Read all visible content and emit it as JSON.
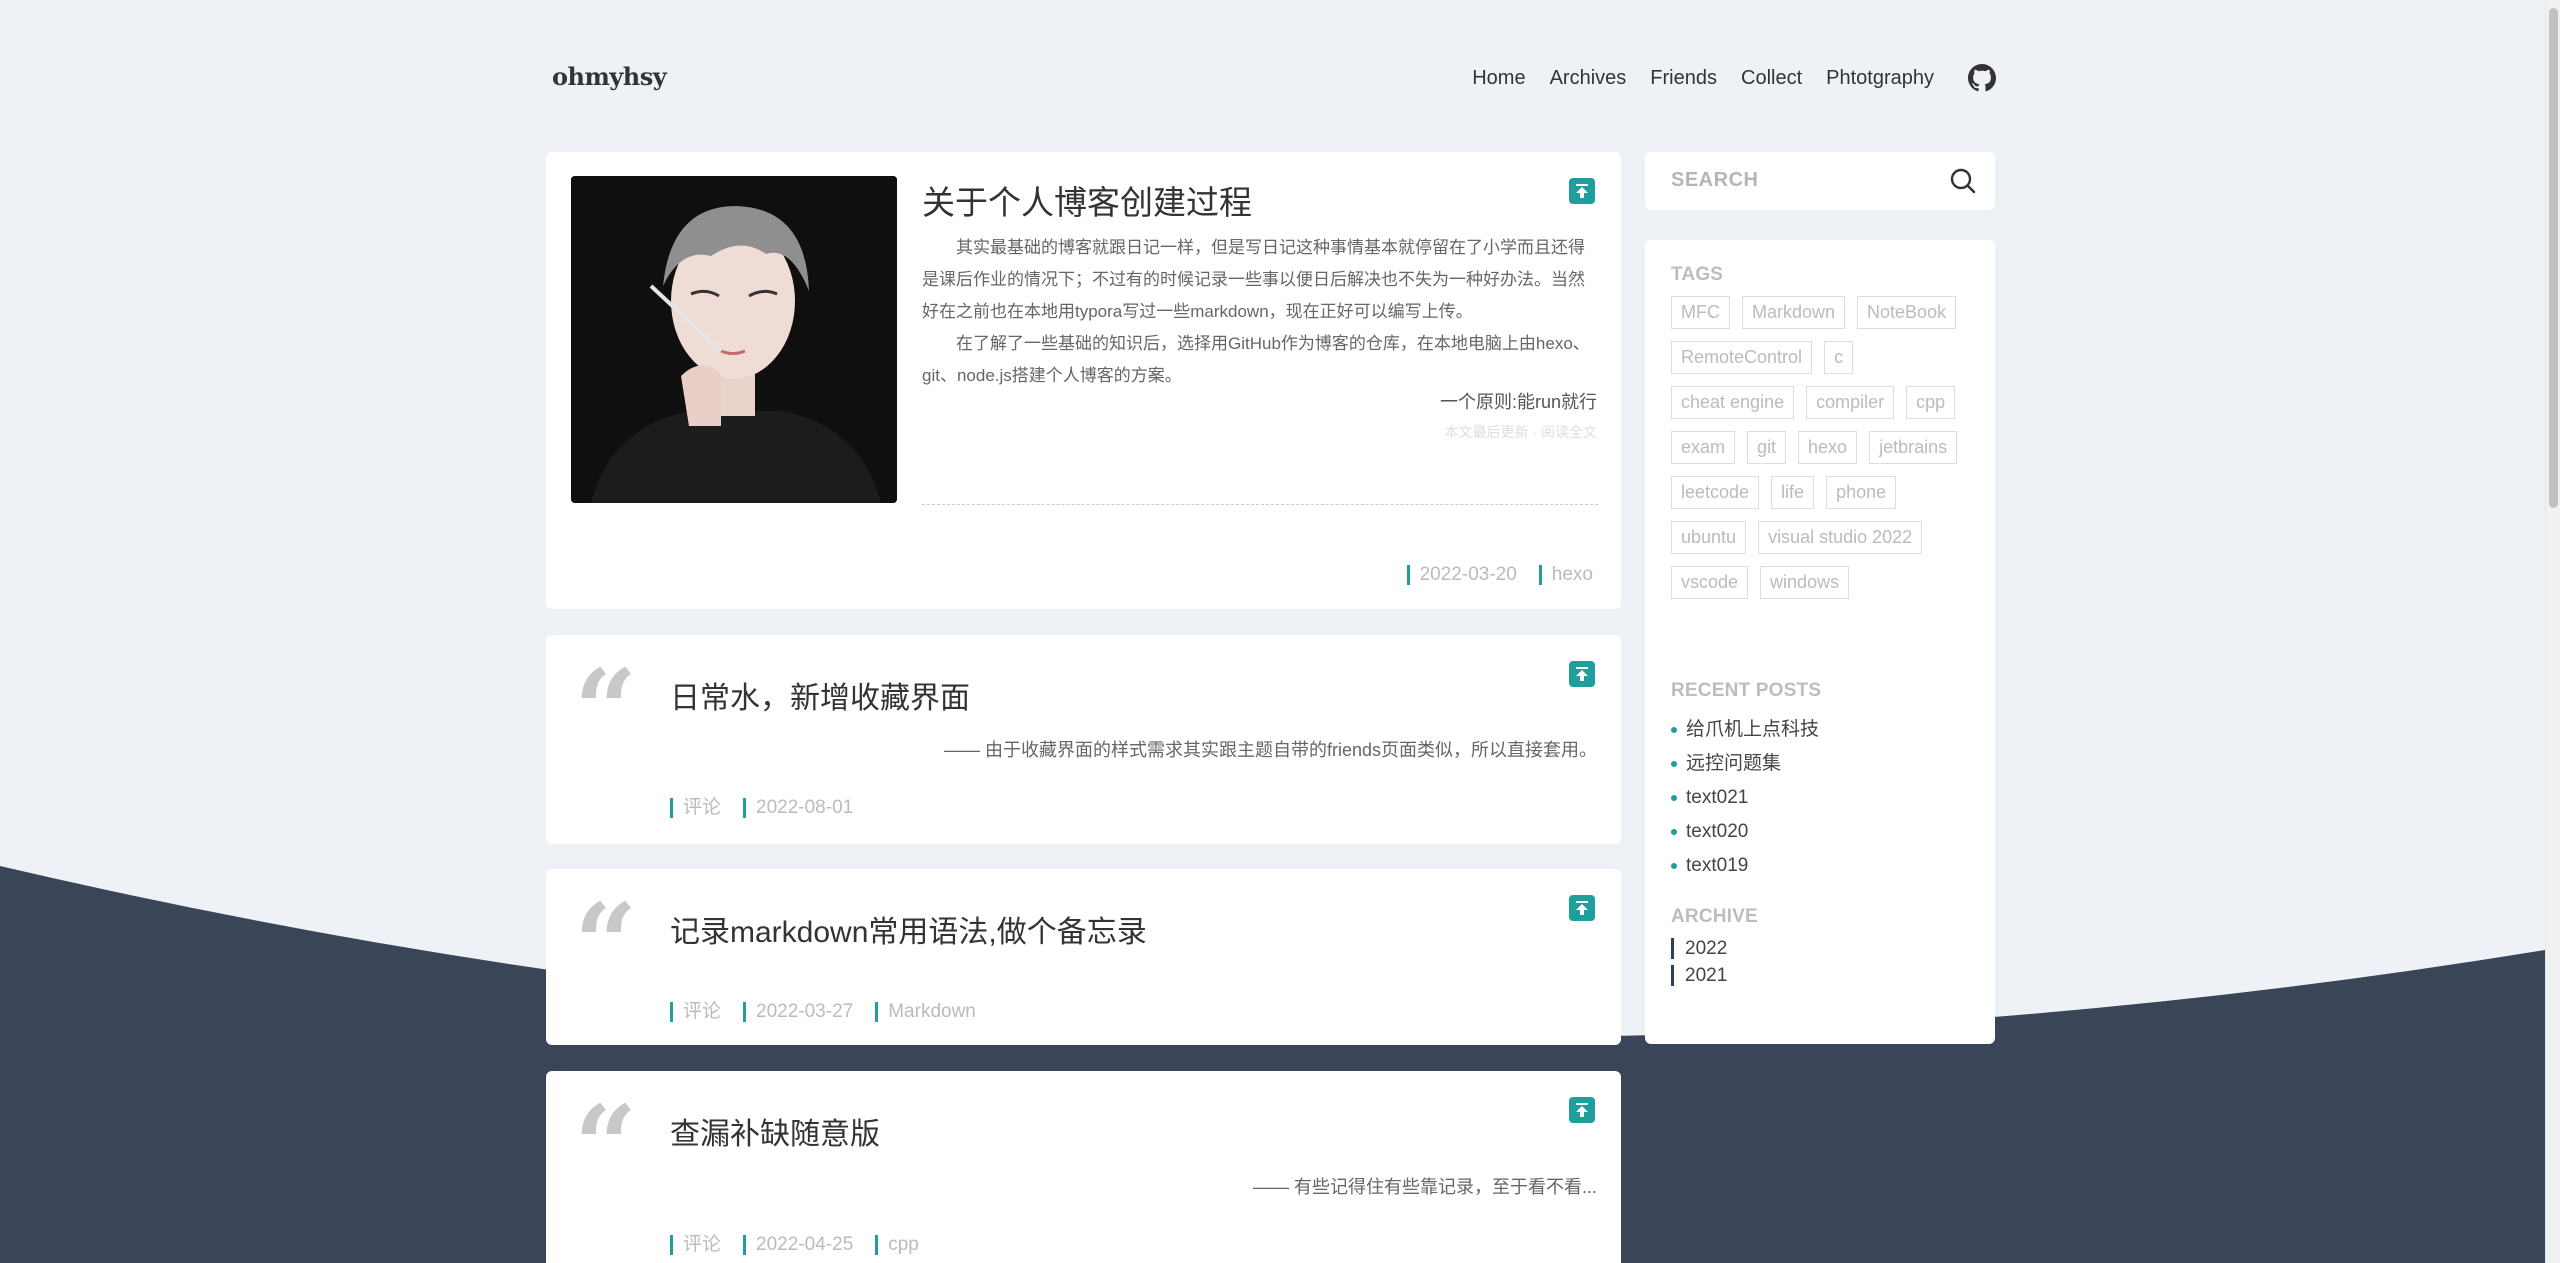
{
  "header": {
    "brand": "ohmyhsy",
    "nav": [
      "Home",
      "Archives",
      "Friends",
      "Collect",
      "Phtotgraphy"
    ]
  },
  "colors": {
    "accent": "#1f9e9e",
    "wave": "#3a4658",
    "background": "#eef2f6"
  },
  "icons": {
    "github": "github-icon",
    "search": "search-icon",
    "pin": "pin-top-icon",
    "quote": "quote-icon"
  },
  "posts": [
    {
      "title": "关于个人博客创建过程",
      "excerpt": [
        "其实最基础的博客就跟日记一样，但是写日记这种事情基本就停留在了小学而且还得是课后作业的情况下；不过有的时候记录一些事以便日后解决也不失为一种好办法。当然好在之前也在本地用typora写过一些markdown，现在正好可以编写上传。",
        "在了解了一些基础的知识后，选择用GitHub作为博客的仓库，在本地电脑上由hexo、git、node.js搭建个人博客的方案。"
      ],
      "quote": "一个原则:能run就行",
      "faint": "本文最后更新 · 阅读全文",
      "date": "2022-03-20",
      "tag": "hexo"
    },
    {
      "title": "日常水，新增收藏界面",
      "subtitle": "—— 由于收藏界面的样式需求其实跟主题自带的friends页面类似，所以直接套用。",
      "comment": "评论",
      "date": "2022-08-01"
    },
    {
      "title": "记录markdown常用语法,做个备忘录",
      "comment": "评论",
      "date": "2022-03-27",
      "tag": "Markdown"
    },
    {
      "title": "查漏补缺随意版",
      "subtitle": "—— 有些记得住有些靠记录，至于看不看...",
      "comment": "评论",
      "date": "2022-04-25",
      "tag": "cpp"
    }
  ],
  "sidebar": {
    "search_placeholder": "SEARCH",
    "tags_title": "TAGS",
    "tags": [
      "MFC",
      "Markdown",
      "NoteBook",
      "RemoteControl",
      "c",
      "cheat engine",
      "compiler",
      "cpp",
      "exam",
      "git",
      "hexo",
      "jetbrains",
      "leetcode",
      "life",
      "phone",
      "ubuntu",
      "visual studio 2022",
      "vscode",
      "windows"
    ],
    "recent_title": "RECENT POSTS",
    "recent": [
      "给爪机上点科技",
      "远控问题集",
      "text021",
      "text020",
      "text019"
    ],
    "archive_title": "ARCHIVE",
    "archive": [
      "2022",
      "2021"
    ]
  }
}
